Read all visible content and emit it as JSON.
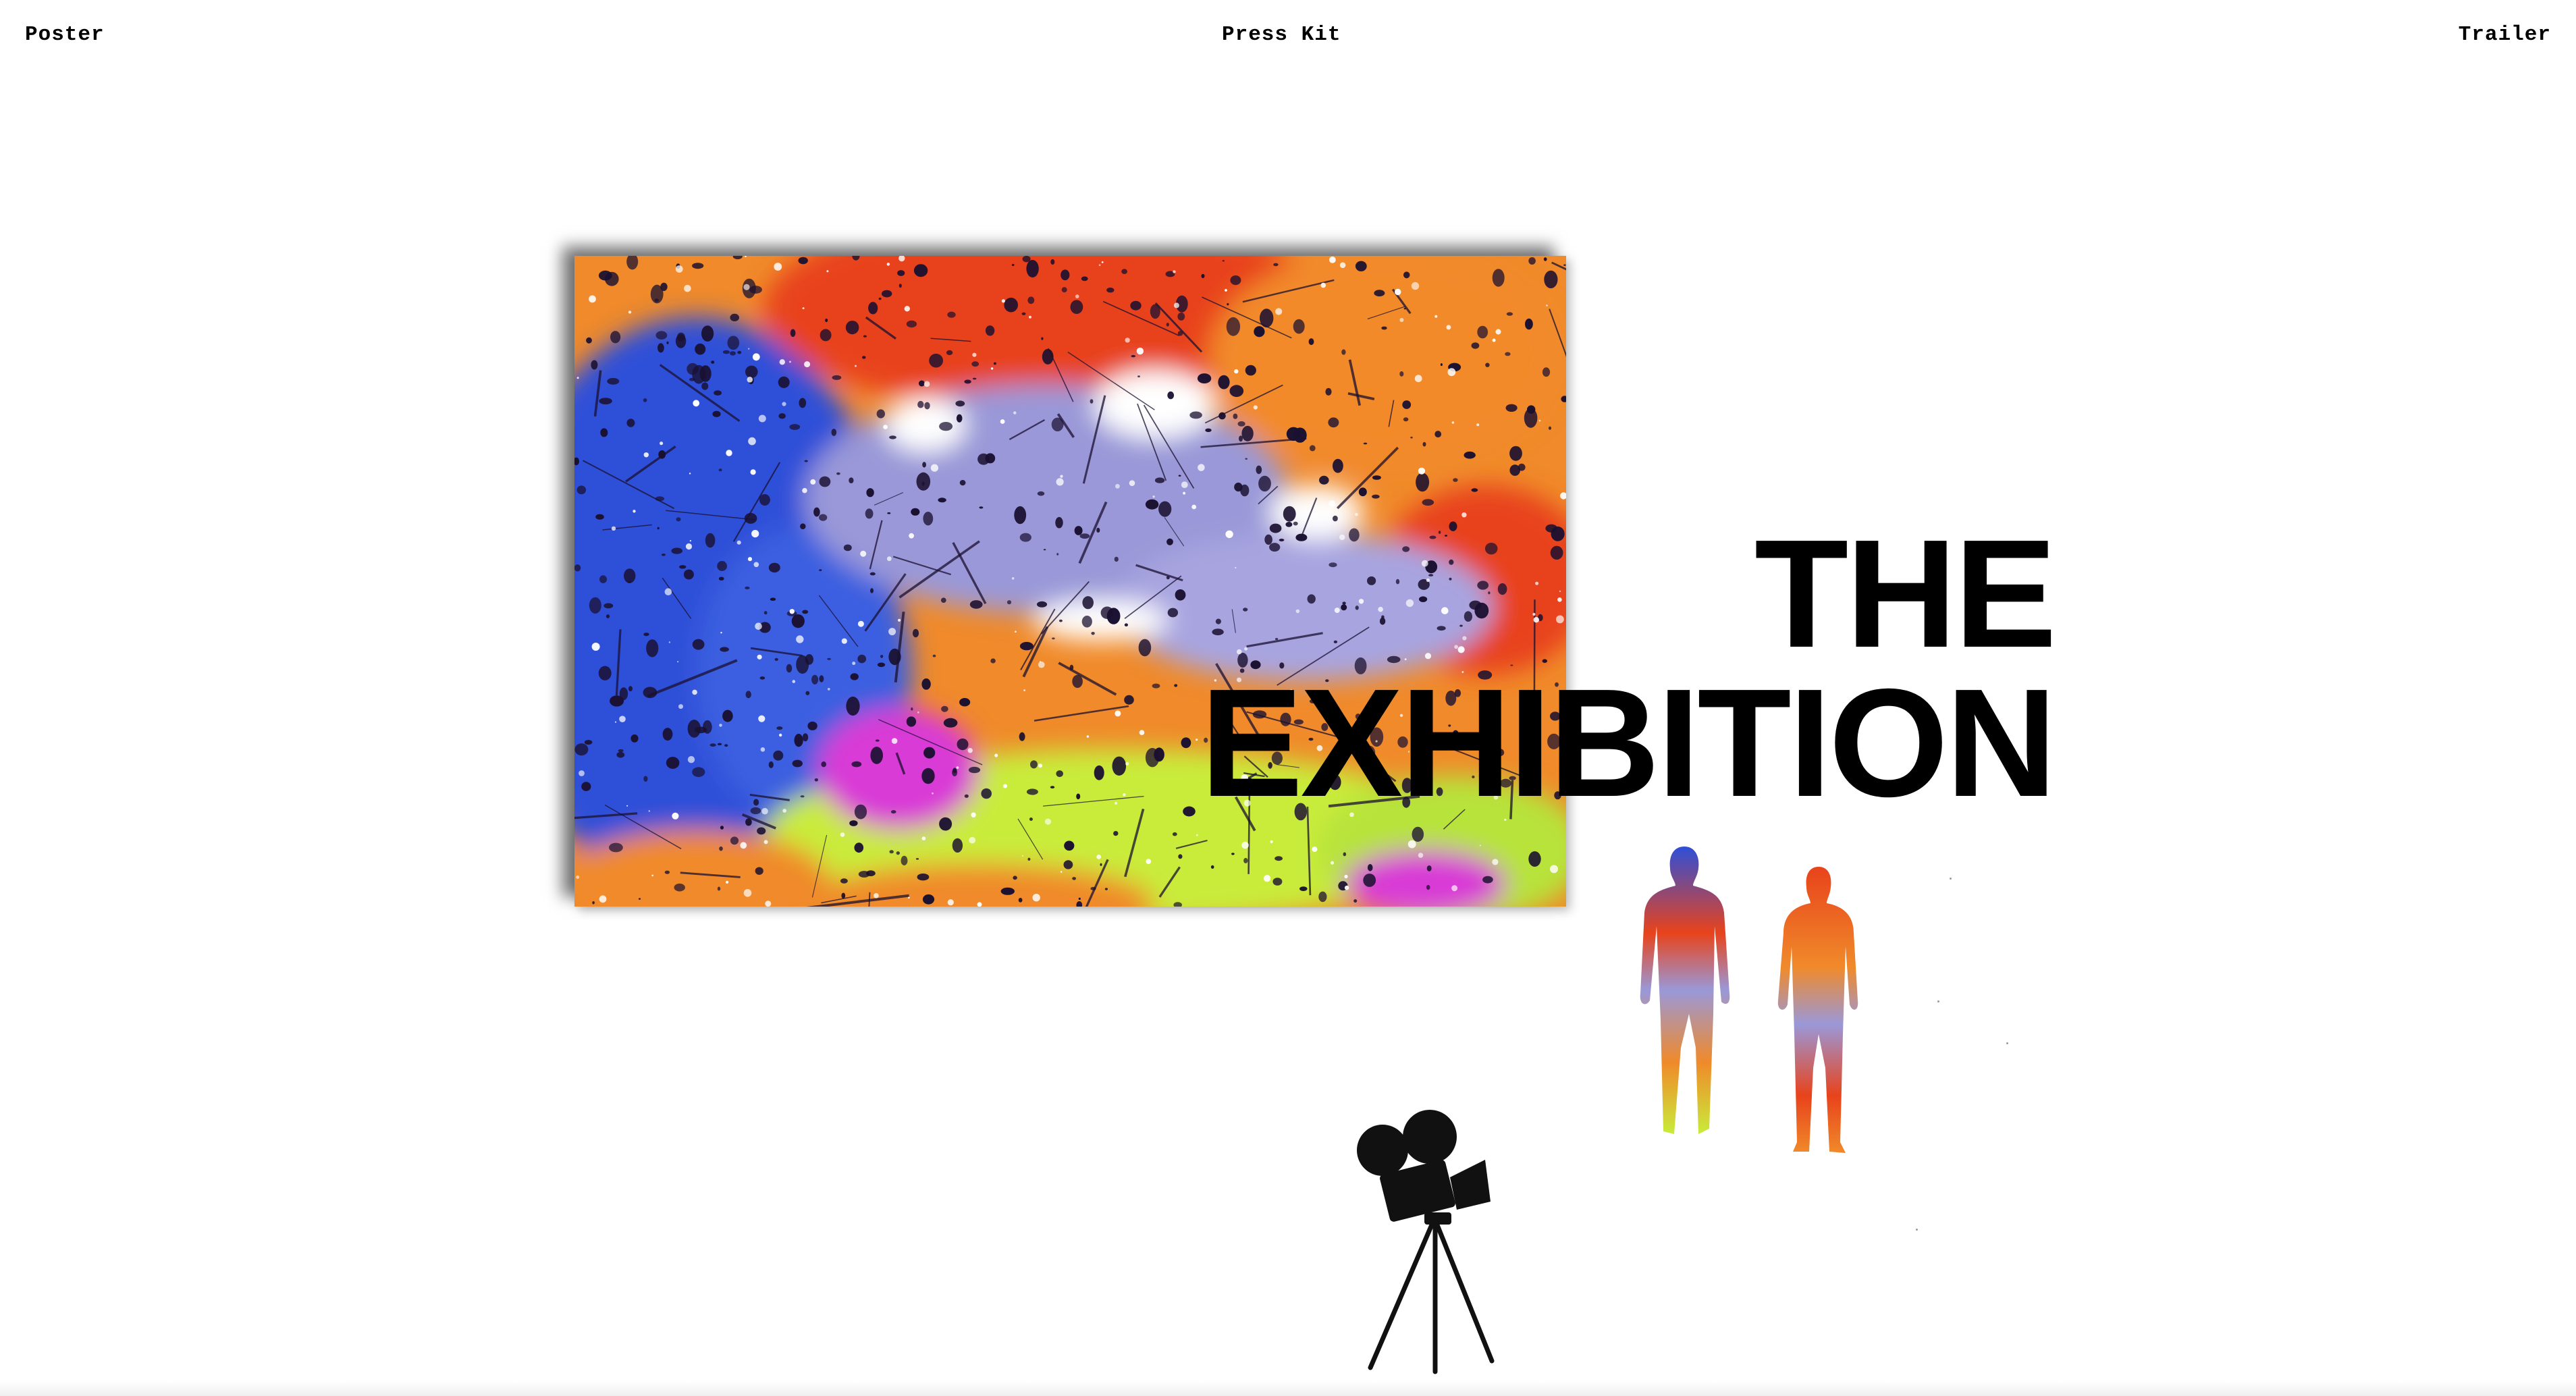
{
  "nav": {
    "poster_label": "Poster",
    "presskit_label": "Press Kit",
    "trailer_label": "Trailer"
  },
  "title": {
    "line1": "THE",
    "line2": "EXHIBITION"
  },
  "icons": {
    "camera": "movie-camera-icon",
    "figures": "painted-person-silhouette"
  },
  "colors": {
    "background": "#ffffff",
    "text": "#000000",
    "paint_blue": "#2f4fd8",
    "paint_orange": "#f07a1e",
    "paint_red": "#e8431b",
    "paint_lavender": "#9a98d8",
    "paint_lime": "#c9ec3a",
    "paint_magenta": "#d93ad6"
  }
}
